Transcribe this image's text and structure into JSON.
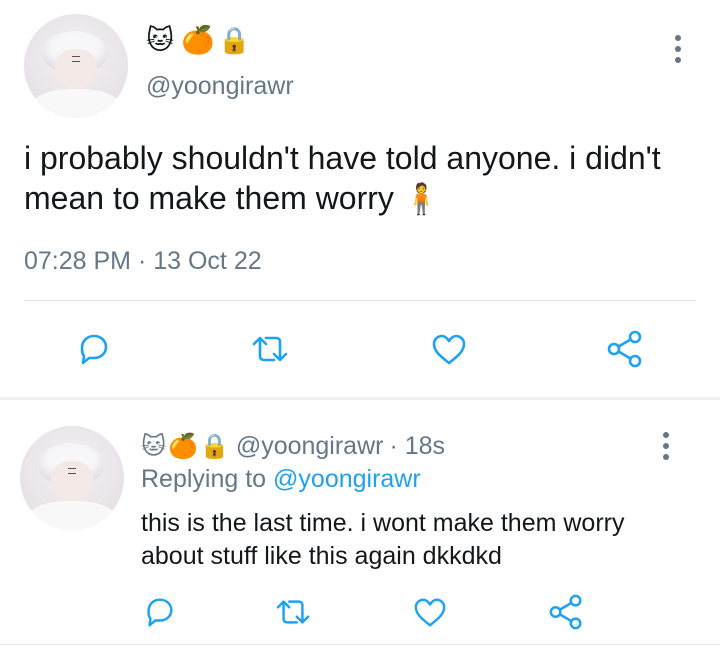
{
  "colors": {
    "text": "#14171a",
    "secondary": "#657786",
    "accent": "#1da1f2",
    "divider": "#e1e8ed",
    "icon": "#657786"
  },
  "main_tweet": {
    "badges": [
      "🐱",
      "🍊",
      "🔒"
    ],
    "handle": "@yoongirawr",
    "text": "i probably shouldn't have told anyone. i didn't mean to make them worry",
    "text_emoji": "🧍",
    "timestamp": "07:28 PM · 13 Oct 22",
    "actions": [
      "reply-icon",
      "retweet-icon",
      "like-icon",
      "share-icon"
    ]
  },
  "reply_tweet": {
    "badges": [
      "🐱",
      "🍊",
      "🔒"
    ],
    "handle": "@yoongirawr",
    "time_ago": "· 18s",
    "replying_prefix": "Replying to",
    "replying_to": "@yoongirawr",
    "text": "this is the last time. i wont make them worry about stuff like this again dkkdkd",
    "actions": [
      "reply-icon",
      "retweet-icon",
      "like-icon",
      "share-icon"
    ]
  }
}
